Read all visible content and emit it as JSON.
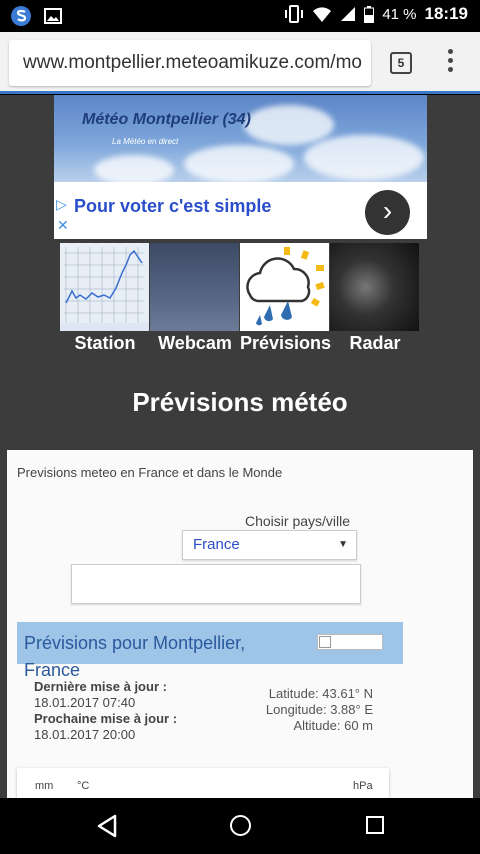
{
  "status_bar": {
    "battery_percent": "41 %",
    "time": "18:19"
  },
  "browser": {
    "url": "www.montpellier.meteoamikuze.com/mo",
    "tab_count": "5"
  },
  "banner": {
    "title": "Météo Montpellier (34)",
    "subtitle": "La Météo en direct"
  },
  "ad": {
    "text": "Pour voter c'est simple"
  },
  "nav": {
    "items": [
      {
        "label": "Station"
      },
      {
        "label": "Webcam"
      },
      {
        "label": "Prévisions"
      },
      {
        "label": "Radar"
      }
    ]
  },
  "page": {
    "title": "Prévisions météo",
    "intro": "Previsions meteo en France et dans le Monde",
    "choose_label": "Choisir pays/ville",
    "country_selected": "France",
    "city_input_value": ""
  },
  "forecast": {
    "title_line1": "Prévisions pour Montpellier,",
    "title_line2": "France",
    "last_update_label": "Dernière mise à jour :",
    "last_update_value": "18.01.2017 07:40",
    "next_update_label": "Prochaine mise à jour :",
    "next_update_value": "18.01.2017 20:00",
    "latitude": "Latitude: 43.61° N",
    "longitude": "Longitude: 3.88° E",
    "altitude": "Altitude: 60 m"
  },
  "table_headers": {
    "mm": "mm",
    "celsius": "°C",
    "hpa": "hPa"
  }
}
